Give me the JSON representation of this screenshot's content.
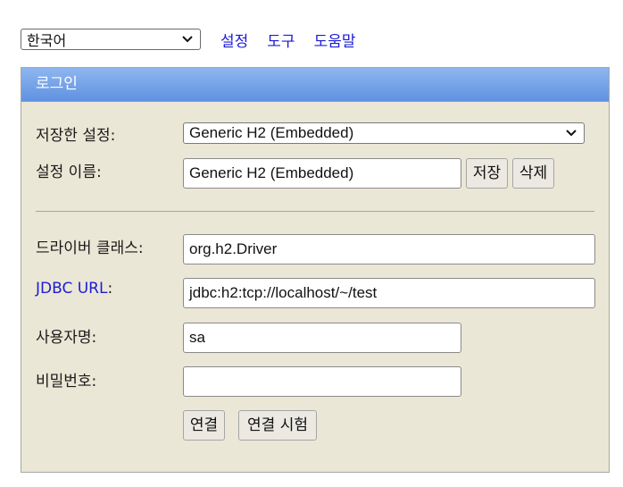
{
  "topbar": {
    "language_value": "한국어",
    "links": [
      "설정",
      "도구",
      "도움말"
    ]
  },
  "panel": {
    "title": "로그인",
    "saved_settings_label": "저장한 설정:",
    "saved_settings_value": "Generic H2 (Embedded)",
    "setting_name_label": "설정 이름:",
    "setting_name_value": "Generic H2 (Embedded)",
    "save_button": "저장",
    "delete_button": "삭제",
    "driver_class_label": "드라이버 클래스:",
    "driver_class_value": "org.h2.Driver",
    "jdbc_url_link": "JDBC URL",
    "jdbc_url_colon": ":",
    "jdbc_url_value": "jdbc:h2:tcp://localhost/~/test",
    "username_label": "사용자명:",
    "username_value": "sa",
    "password_label": "비밀번호:",
    "password_value": "",
    "connect_button": "연결",
    "test_connection_button": "연결 시험"
  },
  "colors": {
    "panel_bg": "#ebe7d6",
    "header_gradient_top": "#8fb6ef",
    "header_gradient_bottom": "#5f92e2",
    "link": "#1c1cd6"
  }
}
